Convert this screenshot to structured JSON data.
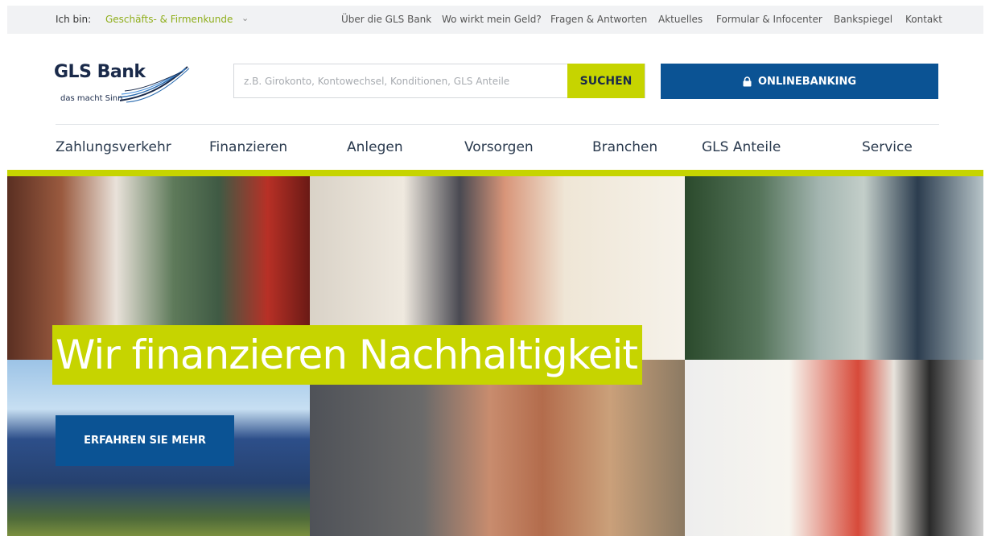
{
  "topbar": {
    "iam_label": "Ich bin:",
    "segment": "Geschäfts- & Firmenkunde",
    "chevron": "⌄",
    "links": [
      "Über die GLS Bank",
      "Wo wirkt mein Geld?",
      "Fragen & Antworten",
      "Aktuelles",
      "Formular & Infocenter",
      "Bankspiegel",
      "Kontakt"
    ]
  },
  "brand": {
    "name": "GLS Bank",
    "tagline": "das macht Sinn",
    "color": "#1a2a4a"
  },
  "search": {
    "placeholder": "z.B. Girokonto, Kontowechsel, Konditionen, GLS Anteile",
    "value": "",
    "button_label": "SUCHEN"
  },
  "onlinebanking": {
    "icon": "lock-icon",
    "label": "ONLINEBANKING"
  },
  "main_nav": [
    "Zahlungsverkehr",
    "Finanzieren",
    "Anlegen",
    "Vorsorgen",
    "Branchen",
    "GLS Anteile",
    "Service"
  ],
  "hero": {
    "headline": "Wir finanzieren Nachhaltigkeit",
    "cta_label": "ERFAHREN SIE MEHR"
  },
  "colors": {
    "accent_lime": "#c6d400",
    "brand_blue": "#0b5394",
    "topbar_bg": "#f1f2f4",
    "segment_green": "#8fae1b"
  }
}
